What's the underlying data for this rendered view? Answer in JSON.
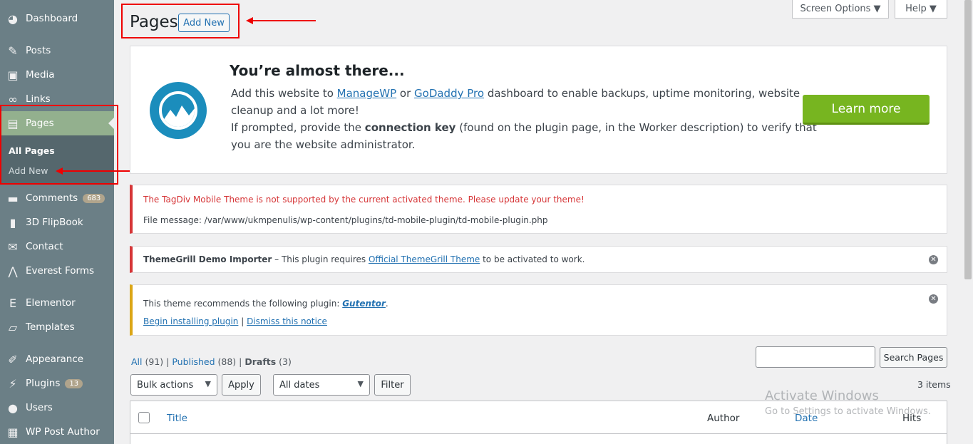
{
  "sidebar": {
    "items": [
      {
        "label": "Dashboard",
        "icon": "dashboard-icon",
        "glyph": "◕"
      },
      {
        "label": "Posts",
        "icon": "pin-icon",
        "glyph": "✎"
      },
      {
        "label": "Media",
        "icon": "media-icon",
        "glyph": "▣"
      },
      {
        "label": "Links",
        "icon": "link-icon",
        "glyph": "∞"
      },
      {
        "label": "Pages",
        "icon": "pages-icon",
        "glyph": "▤"
      },
      {
        "label": "Comments",
        "icon": "comment-icon",
        "glyph": "▬",
        "badge": "683"
      },
      {
        "label": "3D FlipBook",
        "icon": "book-icon",
        "glyph": "▮"
      },
      {
        "label": "Contact",
        "icon": "mail-icon",
        "glyph": "✉"
      },
      {
        "label": "Everest Forms",
        "icon": "everest-icon",
        "glyph": "⋀"
      },
      {
        "label": "Elementor",
        "icon": "elementor-icon",
        "glyph": "E"
      },
      {
        "label": "Templates",
        "icon": "folder-icon",
        "glyph": "▱"
      },
      {
        "label": "Appearance",
        "icon": "brush-icon",
        "glyph": "✐"
      },
      {
        "label": "Plugins",
        "icon": "plug-icon",
        "glyph": "⚡",
        "badge": "13"
      },
      {
        "label": "Users",
        "icon": "user-icon",
        "glyph": "●"
      },
      {
        "label": "WP Post Author",
        "icon": "author-icon",
        "glyph": "▦"
      }
    ],
    "submenu": {
      "all_pages": "All Pages",
      "add_new": "Add New"
    }
  },
  "header": {
    "title": "Pages",
    "add_new": "Add New",
    "screen_options": "Screen Options ▼",
    "help": "Help ▼"
  },
  "mwp": {
    "title": "You’re almost there...",
    "line1_pre": "Add this website to ",
    "link1": "ManageWP",
    "line1_mid": " or ",
    "link2": "GoDaddy Pro",
    "line1_post": " dashboard to enable backups, uptime monitoring, website",
    "line2": "cleanup and a lot more!",
    "line3_pre": "If prompted, provide the ",
    "line3_bold": "connection key",
    "line3_post": " (found on the plugin page, in the Worker description) to verify that",
    "line4": "you are the website administrator.",
    "button": "Learn more"
  },
  "notices": {
    "tagdiv_title": "The TagDiv Mobile Theme is not supported by the current activated theme. Please update your theme!",
    "tagdiv_file": "File message: /var/www/ukmpenulis/wp-content/plugins/td-mobile-plugin/td-mobile-plugin.php",
    "themegrill_bold": "ThemeGrill Demo Importer",
    "themegrill_mid": " – This plugin requires ",
    "themegrill_link": "Official ThemeGrill Theme",
    "themegrill_post": " to be activated to work.",
    "plugin_pre": "This theme recommends the following plugin: ",
    "plugin_link": "Gutentor",
    "plugin_post": ".",
    "begin_install": "Begin installing plugin",
    "separator": " | ",
    "dismiss_notice": "Dismiss this notice"
  },
  "filters": {
    "all": "All",
    "all_count": "(91)",
    "published": "Published",
    "published_count": "(88)",
    "drafts": "Drafts",
    "drafts_count": "(3)",
    "sep": " | ",
    "bulk_actions": "Bulk actions",
    "apply": "Apply",
    "all_dates": "All dates",
    "filter": "Filter",
    "search_button": "Search Pages",
    "items": "3 items"
  },
  "table": {
    "columns": {
      "title": "Title",
      "author": "Author",
      "date": "Date",
      "hits": "Hits"
    }
  },
  "watermark": {
    "title": "Activate Windows",
    "subtitle": "Go to Settings to activate Windows."
  },
  "colors": {
    "sidebar": "#6b7f86",
    "active_menu": "#93b08e",
    "link": "#2271b1",
    "learn_more": "#77b520",
    "error": "#d63638",
    "warning": "#dba617",
    "highlight": "#ee0000"
  }
}
